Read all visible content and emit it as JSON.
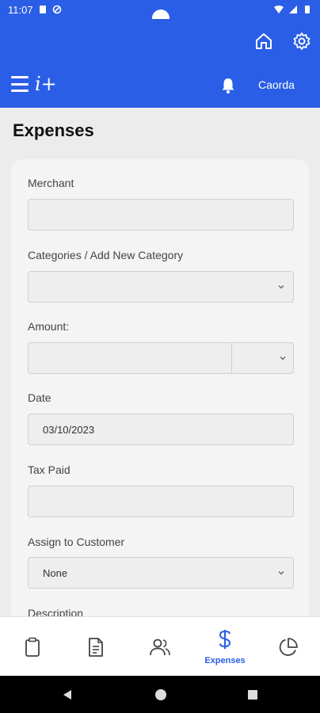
{
  "status_bar": {
    "time": "11:07"
  },
  "header": {
    "user_name": "Caorda"
  },
  "page": {
    "title": "Expenses"
  },
  "form": {
    "merchant": {
      "label": "Merchant",
      "value": ""
    },
    "category": {
      "label": "Categories / Add New Category",
      "value": ""
    },
    "amount": {
      "label": "Amount:",
      "value": "",
      "currency": ""
    },
    "date": {
      "label": "Date",
      "value": "03/10/2023"
    },
    "tax": {
      "label": "Tax Paid",
      "value": ""
    },
    "customer": {
      "label": "Assign to Customer",
      "value": "None"
    },
    "description": {
      "label": "Description"
    }
  },
  "bottom_nav": {
    "active_label": "Expenses"
  },
  "colors": {
    "brand": "#2a5ee6",
    "background": "#ececec",
    "card": "#f4f4f4"
  },
  "icons": [
    "wifi-icon",
    "signal-icon",
    "battery-icon",
    "home-icon",
    "gear-icon",
    "menu-icon",
    "bell-icon",
    "clipboard-icon",
    "document-icon",
    "people-icon",
    "dollar-icon",
    "pie-chart-icon",
    "back-icon",
    "home-circle-icon",
    "recents-icon"
  ]
}
